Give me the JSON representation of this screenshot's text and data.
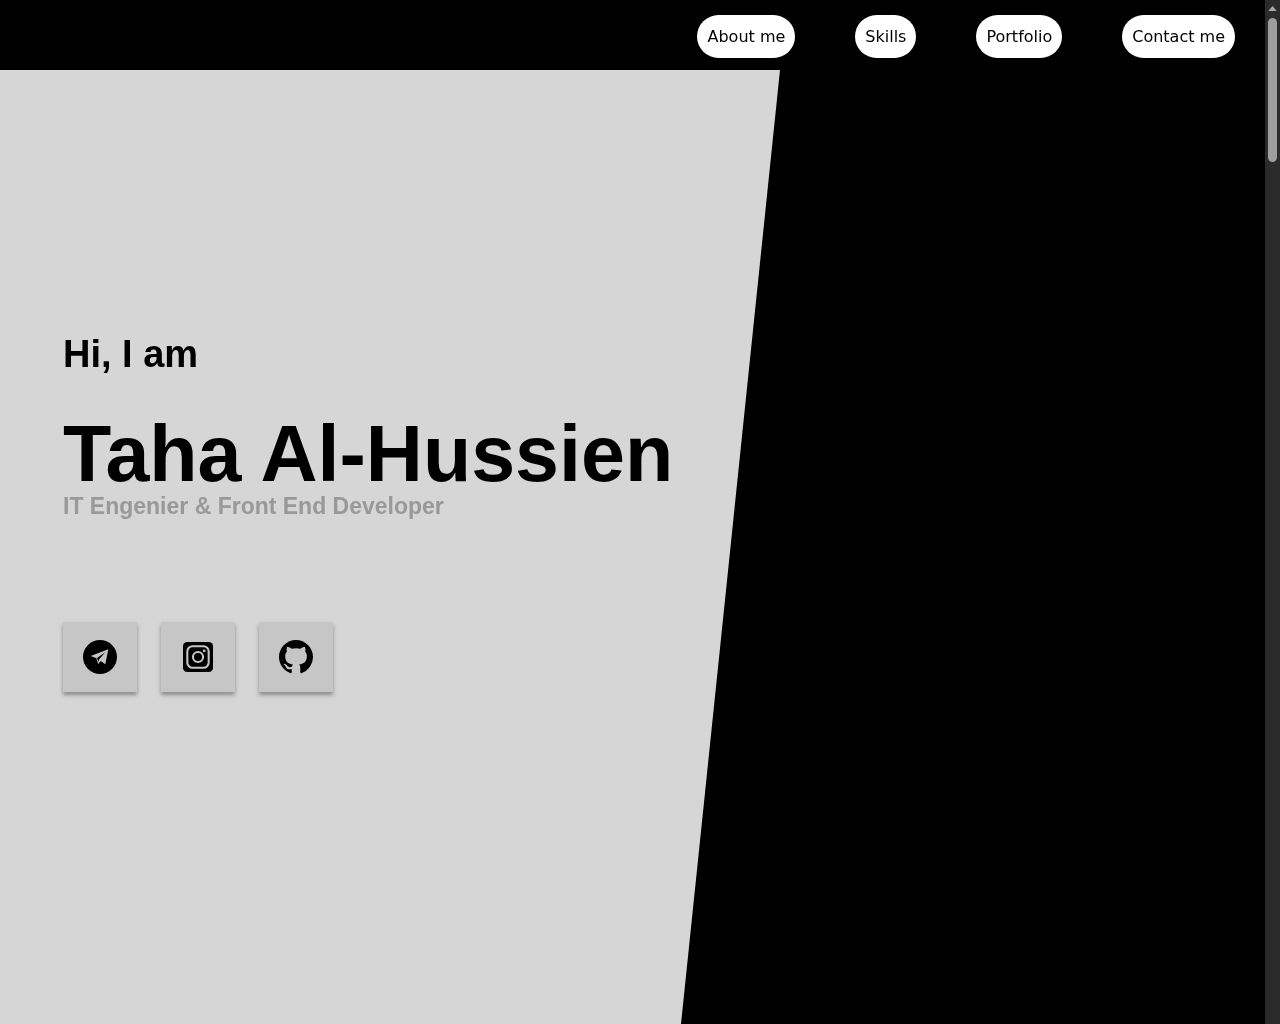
{
  "nav": {
    "items": [
      {
        "label": "About me"
      },
      {
        "label": "Skills"
      },
      {
        "label": "Portfolio"
      },
      {
        "label": "Contact me"
      }
    ]
  },
  "hero": {
    "greeting": "Hi, I am",
    "name": "Taha Al-Hussien",
    "subtitle": "IT Engenier & Front End Developer"
  }
}
